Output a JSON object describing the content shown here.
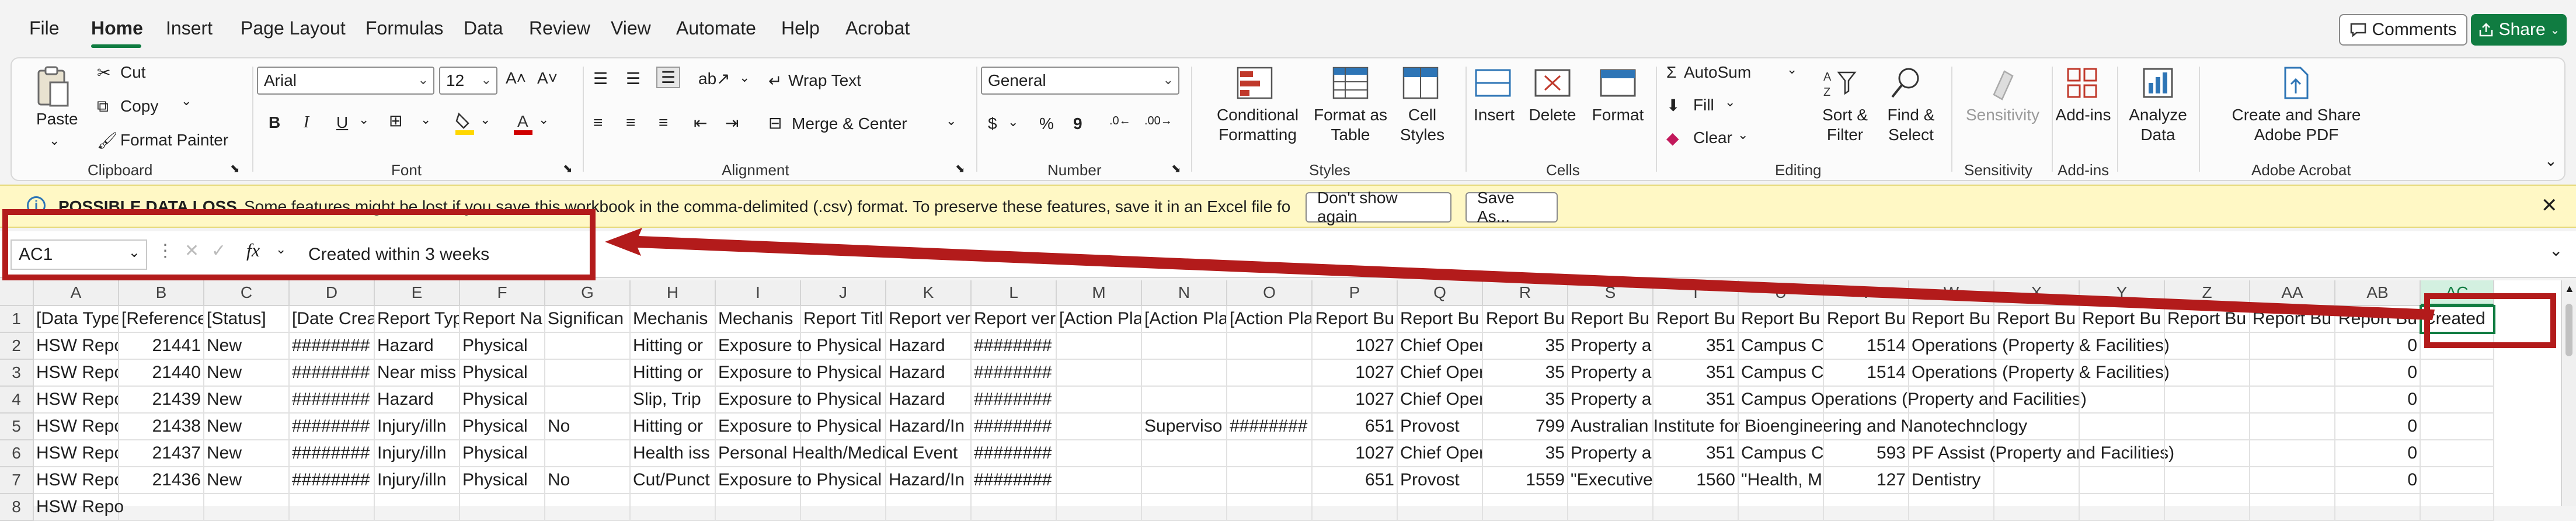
{
  "menu": {
    "items": [
      "File",
      "Home",
      "Insert",
      "Page Layout",
      "Formulas",
      "Data",
      "Review",
      "View",
      "Automate",
      "Help",
      "Acrobat"
    ],
    "active": "Home",
    "comments_label": "Comments",
    "share_label": "Share"
  },
  "ribbon": {
    "clipboard": {
      "paste": "Paste",
      "cut": "Cut",
      "copy": "Copy",
      "format_painter": "Format Painter",
      "label": "Clipboard"
    },
    "font": {
      "name": "Arial",
      "size": "12",
      "label": "Font",
      "bold": "B",
      "italic": "I",
      "underline": "U"
    },
    "alignment": {
      "wrap_text": "Wrap Text",
      "merge_center": "Merge & Center",
      "label": "Alignment"
    },
    "number": {
      "format": "General",
      "label": "Number",
      "currency": "$",
      "percent": "%",
      "comma": "9"
    },
    "styles": {
      "conditional": "Conditional Formatting",
      "format_as_table": "Format as Table",
      "cell_styles": "Cell Styles",
      "label": "Styles"
    },
    "cells": {
      "insert": "Insert",
      "delete": "Delete",
      "format": "Format",
      "label": "Cells"
    },
    "editing": {
      "autosum": "AutoSum",
      "fill": "Fill",
      "clear": "Clear",
      "sort_filter": "Sort & Filter",
      "find_select": "Find & Select",
      "label": "Editing"
    },
    "sensitivity": {
      "button": "Sensitivity",
      "label": "Sensitivity"
    },
    "addins": {
      "button": "Add-ins",
      "label": "Add-ins"
    },
    "analyze": {
      "button": "Analyze Data"
    },
    "acrobat": {
      "button": "Create and Share Adobe PDF",
      "label": "Adobe Acrobat"
    }
  },
  "message_bar": {
    "text_prefix": "POSSIBLE DATA LOSS",
    "text": "Some features might be lost if you save this workbook in the comma-delimited (.csv) format. To preserve these features, save it in an Excel file format.",
    "dont_show": "Don't show again",
    "save_as": "Save As..."
  },
  "formula_bar": {
    "name_box": "AC1",
    "fx": "fx",
    "content": "Created within 3 weeks"
  },
  "sheet": {
    "columns": [
      "A",
      "B",
      "C",
      "D",
      "E",
      "F",
      "G",
      "H",
      "I",
      "J",
      "K",
      "L",
      "M",
      "N",
      "O",
      "P",
      "Q",
      "R",
      "S",
      "T",
      "U",
      "V",
      "W",
      "X",
      "Y",
      "Z",
      "AA",
      "AB",
      "AC"
    ],
    "row_numbers": [
      "1",
      "2",
      "3",
      "4",
      "5",
      "6",
      "7",
      "8"
    ],
    "rows": [
      [
        "[Data Type",
        "[Reference",
        "[Status]",
        "[Date Crea",
        "Report Typ",
        "Report Na",
        "Significan",
        "Mechanis",
        "Mechanis",
        "Report Titl",
        "Report ver",
        "Report ver",
        "[Action Pla",
        "[Action Pla",
        "[Action Pla",
        "Report Bu",
        "Report Bu",
        "Report Bu",
        "Report Bu",
        "Report Bu",
        "Report Bu",
        "Report Bu",
        "Report Bu",
        "Report Bu",
        "Report Bu",
        "Report Bu",
        "Report Bu",
        "Report Bu",
        "Created"
      ],
      [
        "HSW Repo",
        "21441",
        "New",
        "########",
        "Hazard",
        "Physical",
        "",
        "Hitting or",
        "Exposure to Physical",
        "",
        "Hazard",
        "########",
        "",
        "",
        "",
        "1027",
        "Chief Oper",
        "35",
        "Property a",
        "351",
        "Campus C",
        "1514",
        "Operations (Property & Facilities)",
        "",
        "",
        "",
        "",
        "0",
        ""
      ],
      [
        "HSW Repo",
        "21440",
        "New",
        "########",
        "Near miss",
        "Physical",
        "",
        "Hitting or",
        "Exposure to Physical",
        "",
        "Hazard",
        "########",
        "",
        "",
        "",
        "1027",
        "Chief Oper",
        "35",
        "Property a",
        "351",
        "Campus C",
        "1514",
        "Operations (Property & Facilities)",
        "",
        "",
        "",
        "",
        "0",
        ""
      ],
      [
        "HSW Repo",
        "21439",
        "New",
        "########",
        "Hazard",
        "Physical",
        "",
        "Slip, Trip",
        "Exposure to Physical",
        "",
        "Hazard",
        "########",
        "",
        "",
        "",
        "1027",
        "Chief Oper",
        "35",
        "Property a",
        "351",
        "Campus Operations (Property and Facilities)",
        "",
        "",
        "",
        "",
        "",
        "",
        "0",
        ""
      ],
      [
        "HSW Repo",
        "21438",
        "New",
        "########",
        "Injury/illn",
        "Physical",
        "No",
        "Hitting or",
        "Exposure to Physical",
        "",
        "Hazard/In",
        "########",
        "",
        "Superviso",
        "########",
        "651",
        "Provost",
        "799",
        "Australian Institute for Bioengineering and Nanotechnology",
        "",
        "",
        "",
        "",
        "",
        "",
        "",
        "",
        "0",
        ""
      ],
      [
        "HSW Repo",
        "21437",
        "New",
        "########",
        "Injury/illn",
        "Physical",
        "",
        "Health iss",
        "Personal Health/Medical Event",
        "",
        "",
        "########",
        "",
        "",
        "",
        "1027",
        "Chief Oper",
        "35",
        "Property a",
        "351",
        "Campus C",
        "593",
        "PF Assist (Property and Facilities)",
        "",
        "",
        "",
        "",
        "0",
        ""
      ],
      [
        "HSW Repo",
        "21436",
        "New",
        "########",
        "Injury/illn",
        "Physical",
        "No",
        "Cut/Punct",
        "Exposure to Physical",
        "",
        "Hazard/In",
        "########",
        "",
        "",
        "",
        "651",
        "Provost",
        "1559",
        "\"Executive",
        "1560",
        "\"Health, M",
        "127",
        "Dentistry",
        "",
        "",
        "",
        "",
        "0",
        ""
      ],
      [
        "HSW Repo",
        "",
        "",
        "",
        "",
        "",
        "",
        "",
        "",
        "",
        "",
        "",
        "",
        "",
        "",
        "",
        "",
        "",
        "",
        "",
        "",
        "",
        "",
        "",
        "",
        "",
        "",
        "",
        ""
      ]
    ]
  }
}
